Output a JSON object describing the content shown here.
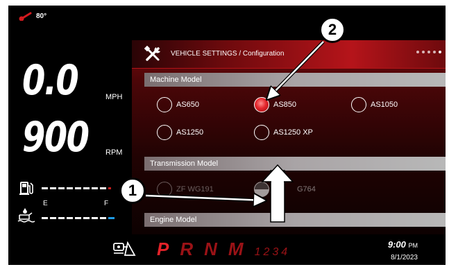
{
  "status": {
    "temperature": "80°"
  },
  "speed": {
    "value": "0.0",
    "unit": "MPH"
  },
  "rpm": {
    "value": "900",
    "unit": "RPM"
  },
  "fuel": {
    "empty_label": "E",
    "full_label": "F"
  },
  "colors": {
    "accent_red": "#b5141a",
    "selected_radio": "#e3262c",
    "def_blue": "#1e9be6",
    "fuel_low_red": "#c81e1e"
  },
  "settings": {
    "title": "VEHICLE SETTINGS / Configuration",
    "page_dots": 5,
    "sections": {
      "machine_model": {
        "title": "Machine Model",
        "options": [
          "AS650",
          "AS850",
          "AS1050",
          "AS1250",
          "AS1250 XP"
        ],
        "selected": "AS850"
      },
      "transmission_model": {
        "title": "Transmission Model",
        "options": [
          "ZF WG191",
          "ZF WG764"
        ],
        "option_visible_texts": [
          "ZF WG191",
          "G764"
        ]
      },
      "engine_model": {
        "title": "Engine Model"
      }
    }
  },
  "gears": {
    "main": [
      "P",
      "R",
      "N",
      "M"
    ],
    "manual": [
      "1",
      "2",
      "3",
      "4"
    ]
  },
  "clock": {
    "time": "9:00",
    "ampm": "PM",
    "date": "8/1/2023"
  },
  "callouts": [
    "1",
    "2"
  ],
  "icons": [
    "thermometer-icon",
    "wrench-screwdriver-icon",
    "fuel-pump-icon",
    "def-fluid-icon",
    "parking-brake-icon"
  ]
}
